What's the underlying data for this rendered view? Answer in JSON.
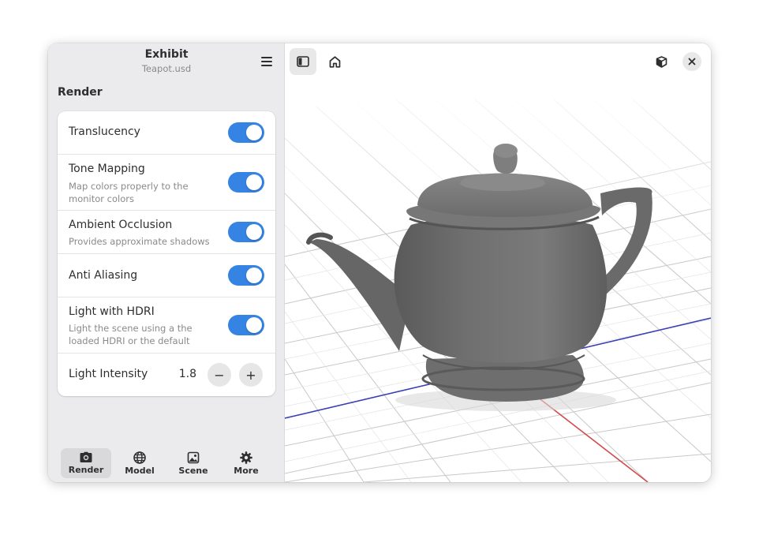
{
  "window": {
    "title": "Exhibit",
    "subtitle": "Teapot.usd"
  },
  "sidebar": {
    "menu_icon": "hamburger-menu-icon",
    "section_title": "Render",
    "settings": [
      {
        "title": "Translucency",
        "subtitle": "",
        "enabled": true
      },
      {
        "title": "Tone Mapping",
        "subtitle": "Map colors properly to the monitor colors",
        "enabled": true
      },
      {
        "title": "Ambient Occlusion",
        "subtitle": "Provides approximate shadows",
        "enabled": true
      },
      {
        "title": "Anti Aliasing",
        "subtitle": "",
        "enabled": true
      },
      {
        "title": "Light with HDRI",
        "subtitle": "Light the scene using a the loaded HDRI or the default",
        "enabled": true
      }
    ],
    "intensity": {
      "label": "Light Intensity",
      "value": "1.8",
      "decrement_symbol": "−",
      "increment_symbol": "+"
    },
    "nav": [
      {
        "label": "Render",
        "icon": "camera-icon",
        "active": true
      },
      {
        "label": "Model",
        "icon": "globe-icon",
        "active": false
      },
      {
        "label": "Scene",
        "icon": "image-icon",
        "active": false
      },
      {
        "label": "More",
        "icon": "gear-icon",
        "active": false
      }
    ]
  },
  "viewport": {
    "toolbar": {
      "sidebar_toggle_icon": "sidebar-toggle-icon",
      "home_icon": "home-icon",
      "orientation_icon": "cube-icon",
      "close_icon": "close-icon"
    },
    "model": "teapot",
    "colors": {
      "accent": "#3584e4",
      "x_axis": "#d24a4a",
      "z_axis": "#3b3fb5",
      "grid": "#c8c8c8",
      "model_gray": "#6e6e6e"
    }
  }
}
